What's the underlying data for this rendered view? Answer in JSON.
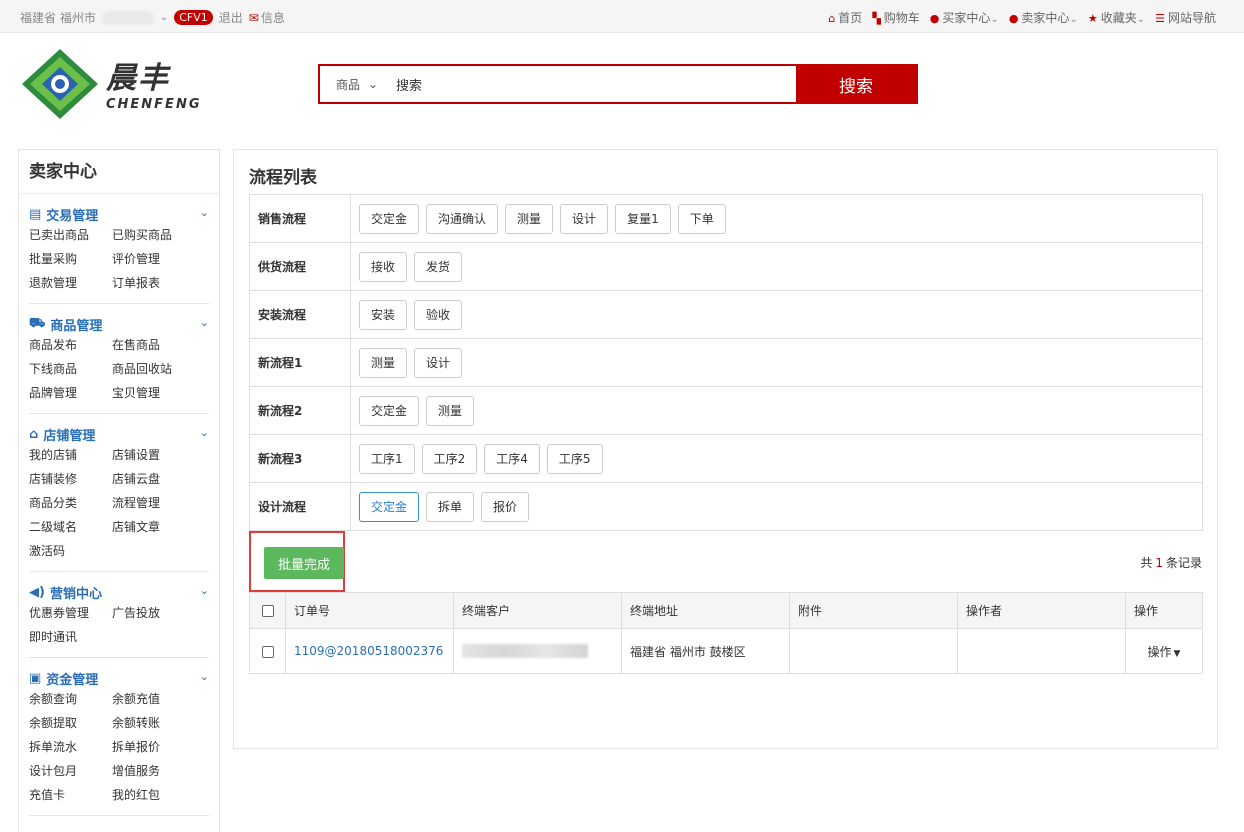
{
  "topbar": {
    "location": "福建省 福州市",
    "badge": "CFV1",
    "logout": "退出",
    "messages": "信息",
    "links": [
      {
        "label": "首页",
        "icon": "home-icon"
      },
      {
        "label": "购物车",
        "icon": "cart-icon"
      },
      {
        "label": "买家中心",
        "icon": "user-icon"
      },
      {
        "label": "卖家中心",
        "icon": "user-icon"
      },
      {
        "label": "收藏夹",
        "icon": "star-icon"
      },
      {
        "label": "网站导航",
        "icon": "grid-icon"
      }
    ]
  },
  "header": {
    "logo_cn": "晨丰",
    "logo_en": "CHENFENG",
    "search_category": "商品",
    "search_value": "搜索",
    "search_button": "搜索"
  },
  "sidebar": {
    "title": "卖家中心",
    "groups": [
      {
        "title": "交易管理",
        "icon": "card-icon",
        "items": [
          "已卖出商品",
          "已购买商品",
          "批量采购",
          "评价管理",
          "退款管理",
          "订单报表"
        ]
      },
      {
        "title": "商品管理",
        "icon": "truck-icon",
        "items": [
          "商品发布",
          "在售商品",
          "下线商品",
          "商品回收站",
          "品牌管理",
          "宝贝管理"
        ]
      },
      {
        "title": "店铺管理",
        "icon": "home-icon",
        "items": [
          "我的店铺",
          "店铺设置",
          "店铺装修",
          "店铺云盘",
          "商品分类",
          "流程管理",
          "二级域名",
          "店铺文章",
          "激活码"
        ]
      },
      {
        "title": "营销中心",
        "icon": "speaker-icon",
        "items": [
          "优惠券管理",
          "广告投放",
          "即时通讯"
        ]
      },
      {
        "title": "资金管理",
        "icon": "money-icon",
        "items": [
          "余额查询",
          "余额充值",
          "余额提取",
          "余额转账",
          "拆单流水",
          "拆单报价",
          "设计包月",
          "增值服务",
          "充值卡",
          "我的红包"
        ]
      }
    ]
  },
  "main": {
    "title": "流程列表",
    "flows": [
      {
        "label": "销售流程",
        "buttons": [
          "交定金",
          "沟通确认",
          "测量",
          "设计",
          "复量1",
          "下单"
        ]
      },
      {
        "label": "供货流程",
        "buttons": [
          "接收",
          "发货"
        ]
      },
      {
        "label": "安装流程",
        "buttons": [
          "安装",
          "验收"
        ]
      },
      {
        "label": "新流程1",
        "buttons": [
          "测量",
          "设计"
        ]
      },
      {
        "label": "新流程2",
        "buttons": [
          "交定金",
          "测量"
        ]
      },
      {
        "label": "新流程3",
        "buttons": [
          "工序1",
          "工序2",
          "工序4",
          "工序5"
        ]
      },
      {
        "label": "设计流程",
        "buttons": [
          "交定金",
          "拆单",
          "报价"
        ],
        "active_index": 0
      }
    ],
    "batch_button": "批量完成",
    "count_prefix": "共",
    "count": "1",
    "count_suffix": "条记录",
    "table": {
      "headers": [
        "订单号",
        "终端客户",
        "终端地址",
        "附件",
        "操作者",
        "操作"
      ],
      "rows": [
        {
          "order_no": "1109@20180518002376",
          "address": "福建省 福州市 鼓楼区",
          "attachment": "",
          "operator": "",
          "action": "操作"
        }
      ]
    }
  },
  "colors": {
    "brand_red": "#c00000",
    "link_blue": "#2a6fb6",
    "batch_green": "#5cb85c"
  }
}
